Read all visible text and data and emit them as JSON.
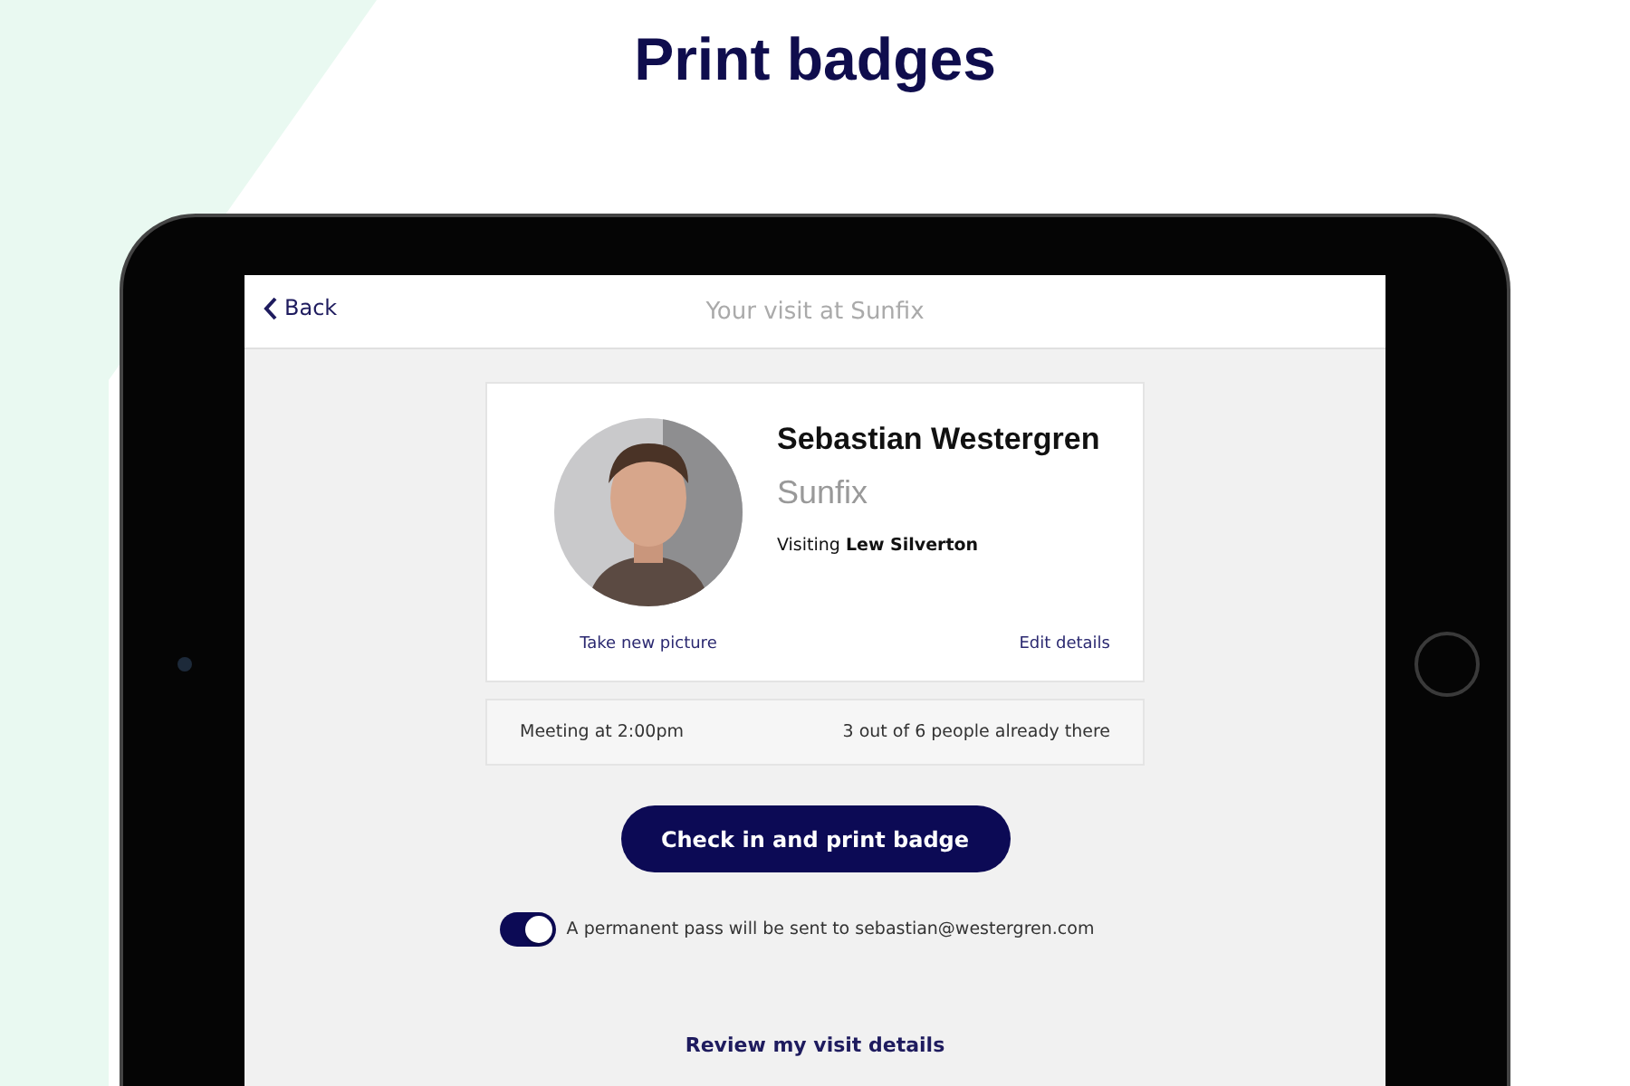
{
  "heading": "Print badges",
  "app": {
    "back": "Back",
    "title": "Your visit at Sunfix",
    "visitor": {
      "name": "Sebastian Westergren",
      "company": "Sunfix",
      "visiting": "Visiting **Lew Silverton**",
      "retake": "Take new picture",
      "edit": "Edit details"
    },
    "meeting": {
      "time": "Meeting at 2:00pm",
      "attendance": "3 out of 6 people already there"
    },
    "primary_button": "Check in and print badge",
    "pass": {
      "on": true,
      "label": "A permanent pass will be sent to sebastian@westergren.com"
    },
    "review_link": "Review my visit details"
  }
}
